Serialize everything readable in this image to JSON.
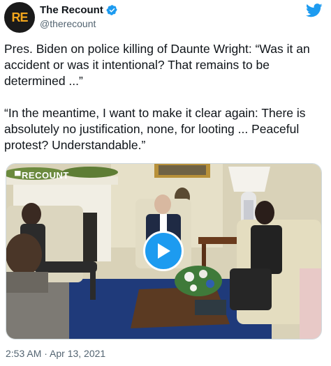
{
  "author": {
    "avatar_text": "RE",
    "display_name": "The Recount",
    "handle": "@therecount",
    "verified_icon": "verified-badge-icon"
  },
  "tweet": {
    "paragraph1": "Pres. Biden on police killing of Daunte Wright: “Was it an accident or was it intentional? That remains to be determined ...”",
    "paragraph2": "“In the meantime, I want to make it clear again: There is absolutely no justification, none, for looting ... Peaceful protest? Understandable.”"
  },
  "media": {
    "watermark": "RECOUNT",
    "play_icon": "play-icon"
  },
  "timestamp": "2:53 AM · Apr 13, 2021",
  "colors": {
    "accent": "#1d9bf0",
    "brand_avatar_bg": "#1a1a1a",
    "brand_avatar_text": "#f2a61c"
  }
}
